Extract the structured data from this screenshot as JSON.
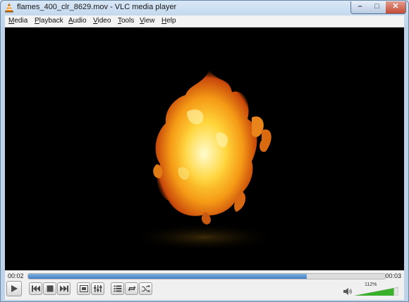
{
  "window": {
    "title": "flames_400_clr_8629.mov - VLC media player"
  },
  "title_buttons": {
    "minimize_icon": "minimize-icon",
    "maximize_icon": "maximize-icon",
    "close_icon": "close-icon"
  },
  "menu": {
    "items": [
      "Media",
      "Playback",
      "Audio",
      "Video",
      "Tools",
      "View",
      "Help"
    ]
  },
  "player": {
    "time_elapsed": "00:02",
    "time_total": "00:03",
    "progress": 0.78
  },
  "controls": {
    "buttons": [
      "play-icon",
      "previous-icon",
      "stop-icon",
      "next-icon",
      "fullscreen-icon",
      "extended-settings-icon",
      "playlist-icon",
      "loop-icon",
      "shuffle-icon"
    ]
  },
  "volume": {
    "percent_text": "112%",
    "level": 1.12
  },
  "colors": {
    "seek_fill": "#3f7fc4",
    "volume_fill": "#38b02a"
  }
}
